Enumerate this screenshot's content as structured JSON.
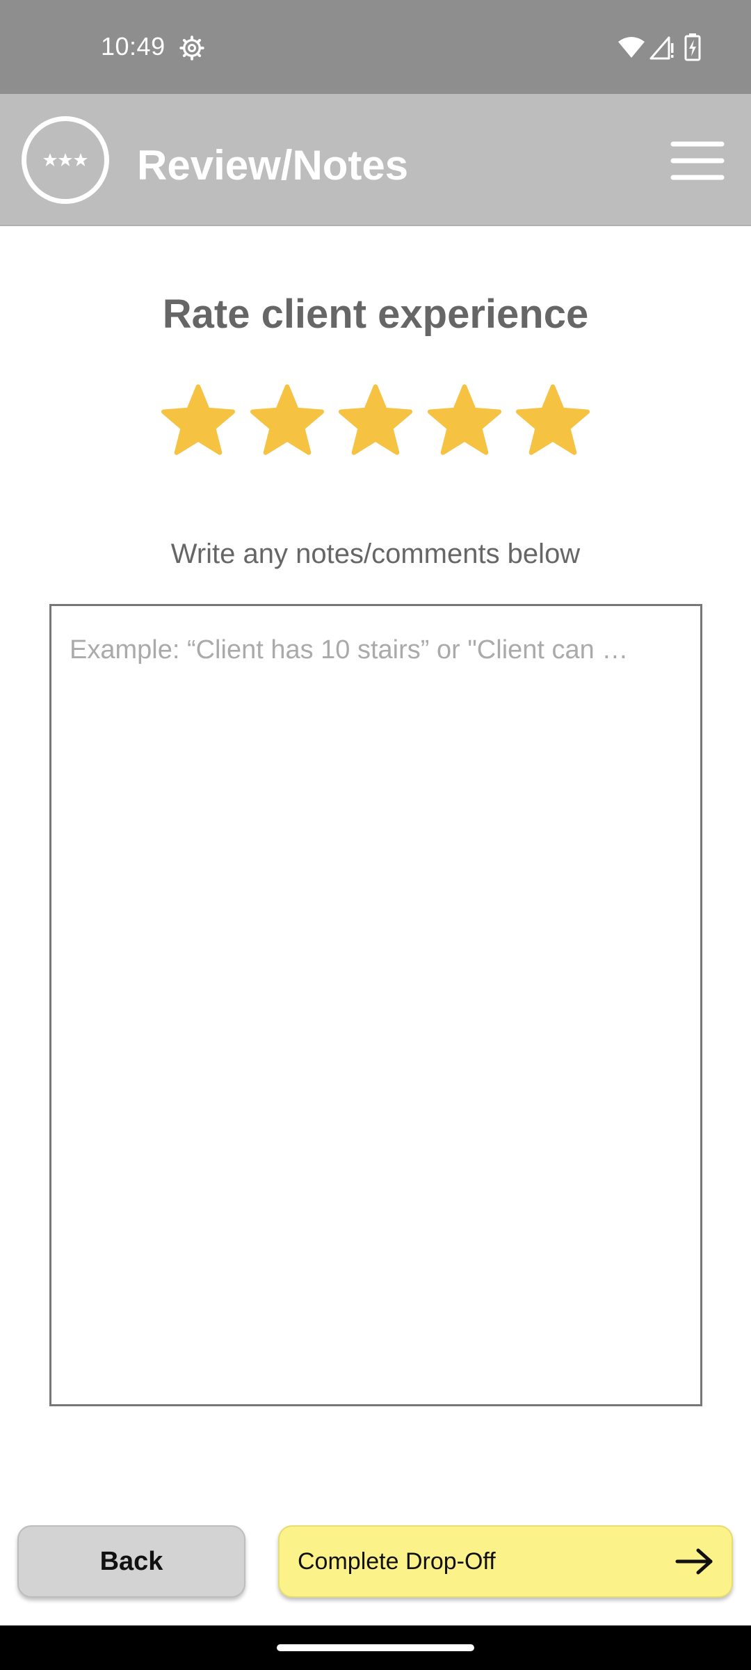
{
  "status_bar": {
    "time": "10:49",
    "icons": [
      "settings-gear-icon",
      "wifi-icon",
      "signal-icon",
      "battery-charging-icon"
    ]
  },
  "header": {
    "title": "Review/Notes",
    "logo_icon": "three-stars-logo-icon",
    "menu_icon": "hamburger-menu-icon",
    "background": "#bdbdbd"
  },
  "rating": {
    "title": "Rate client experience",
    "stars_filled": 5,
    "stars_total": 5,
    "star_color": "#f5c242"
  },
  "notes": {
    "label": "Write any notes/comments below",
    "placeholder": "Example: “Client has 10 stairs” or \"Client can …",
    "value": ""
  },
  "buttons": {
    "back_label": "Back",
    "complete_label": "Complete Drop-Off",
    "complete_icon": "arrow-right-icon",
    "complete_color": "#fbf28a"
  }
}
